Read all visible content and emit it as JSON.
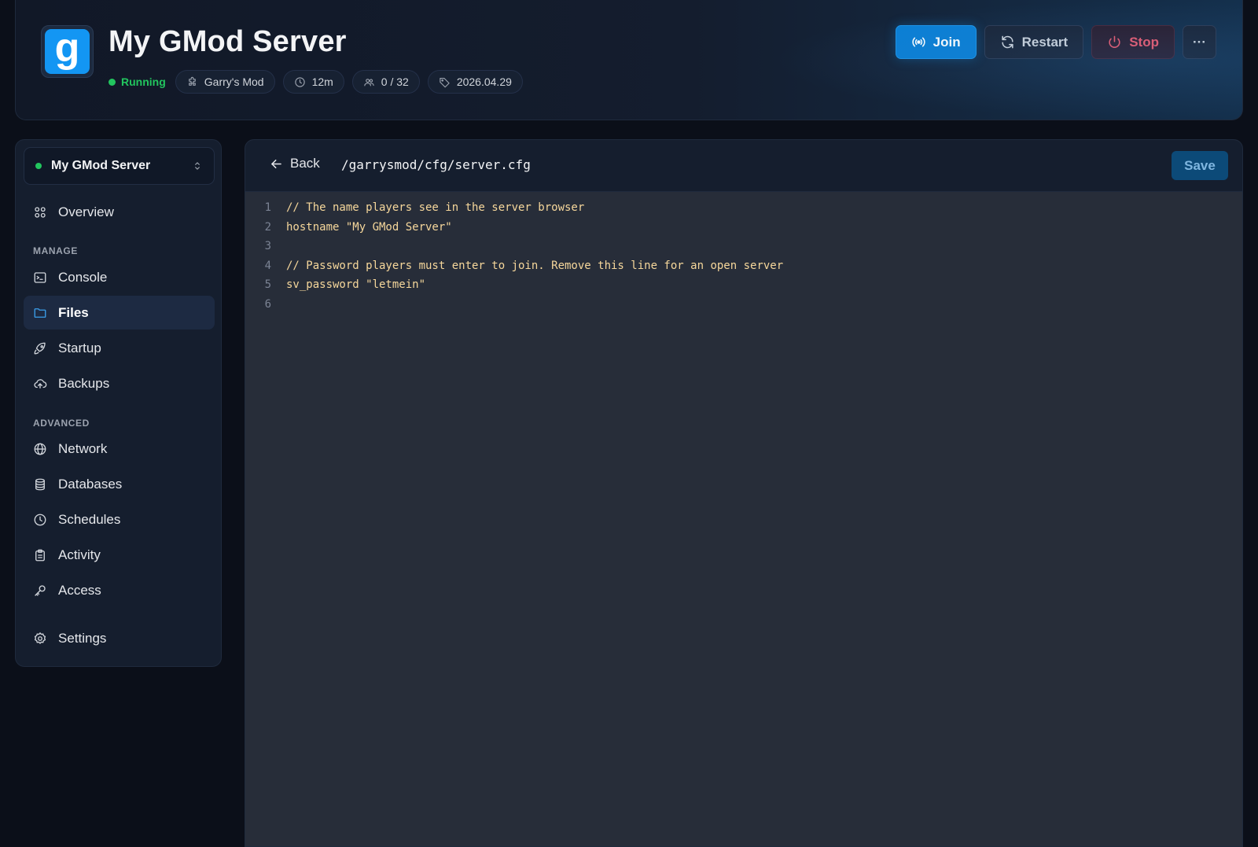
{
  "header": {
    "title": "My GMod Server",
    "status": "Running",
    "pills": [
      {
        "icon": "puzzle-icon",
        "label": "Garry's Mod"
      },
      {
        "icon": "clock-icon",
        "label": "12m"
      },
      {
        "icon": "users-icon",
        "label": "0 / 32"
      },
      {
        "icon": "tag-icon",
        "label": "2026.04.29"
      }
    ],
    "actions": {
      "join_label": "Join",
      "restart_label": "Restart",
      "stop_label": "Stop",
      "more_label": "···"
    }
  },
  "sidebar": {
    "server_name": "My GMod Server",
    "overview_label": "Overview",
    "manage_label": "MANAGE",
    "manage_items": [
      {
        "icon": "terminal-icon",
        "label": "Console"
      },
      {
        "icon": "folder-icon",
        "label": "Files",
        "active": true
      },
      {
        "icon": "rocket-icon",
        "label": "Startup"
      },
      {
        "icon": "cloud-upload-icon",
        "label": "Backups"
      }
    ],
    "advanced_label": "ADVANCED",
    "advanced_items": [
      {
        "icon": "globe-icon",
        "label": "Network"
      },
      {
        "icon": "database-icon",
        "label": "Databases"
      },
      {
        "icon": "clock-icon",
        "label": "Schedules"
      },
      {
        "icon": "clipboard-icon",
        "label": "Activity"
      },
      {
        "icon": "key-icon",
        "label": "Access"
      }
    ],
    "settings_label": "Settings"
  },
  "editor": {
    "back_label": "Back",
    "path": "/garrysmod/cfg/server.cfg",
    "save_label": "Save",
    "lines": [
      {
        "num": "1",
        "text": "// The name players see in the server browser"
      },
      {
        "num": "2",
        "text": "hostname \"My GMod Server\""
      },
      {
        "num": "3",
        "text": ""
      },
      {
        "num": "4",
        "text": "// Password players must enter to join. Remove this line for an open server"
      },
      {
        "num": "5",
        "text": "sv_password \"letmein\""
      },
      {
        "num": "6",
        "text": ""
      }
    ]
  },
  "colors": {
    "accent": "#0b7fd4",
    "running": "#22c55e",
    "stop": "#f0596c",
    "code_text": "#f6d79b"
  }
}
